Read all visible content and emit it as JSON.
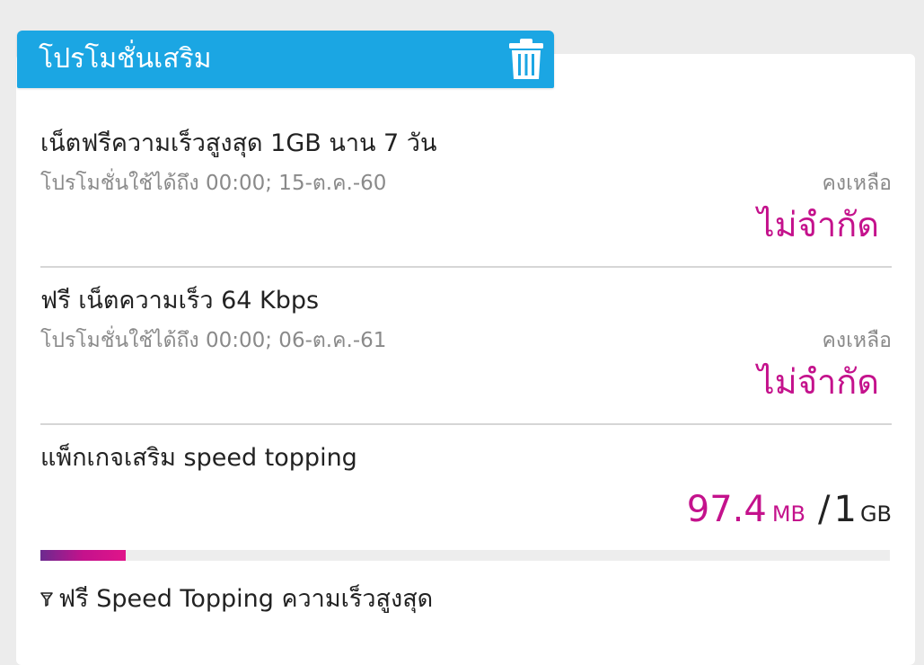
{
  "header": {
    "title": "โปรโมชั่นเสริม",
    "delete_icon": "trash-icon"
  },
  "promotions": [
    {
      "title": "เน็ตฟรีความเร็วสูงสุด 1GB นาน 7 วัน",
      "validity": "โปรโมชั่นใช้ได้ถึง 00:00; 15-ต.ค.-60",
      "remaining_label": "คงเหลือ",
      "remaining_value": "ไม่จำกัด"
    },
    {
      "title": "ฟรี เน็ตความเร็ว 64 Kbps",
      "validity": "โปรโมชั่นใช้ได้ถึง 00:00; 06-ต.ค.-61",
      "remaining_label": "คงเหลือ",
      "remaining_value": "ไม่จำกัด"
    }
  ],
  "package": {
    "title": "แพ็กเกจเสริม speed topping",
    "used": "97.4",
    "used_unit": "MB",
    "separator": "/",
    "total": "1",
    "total_unit": "GB",
    "progress_fraction": 0.1,
    "sub_item_icon": "funnel-icon",
    "sub_item": "ฟรี Speed Topping ความเร็วสูงสุด"
  },
  "colors": {
    "header_bg": "#1ba6e3",
    "accent_magenta": "#c4128c",
    "progress_start": "#6b2a8f"
  }
}
